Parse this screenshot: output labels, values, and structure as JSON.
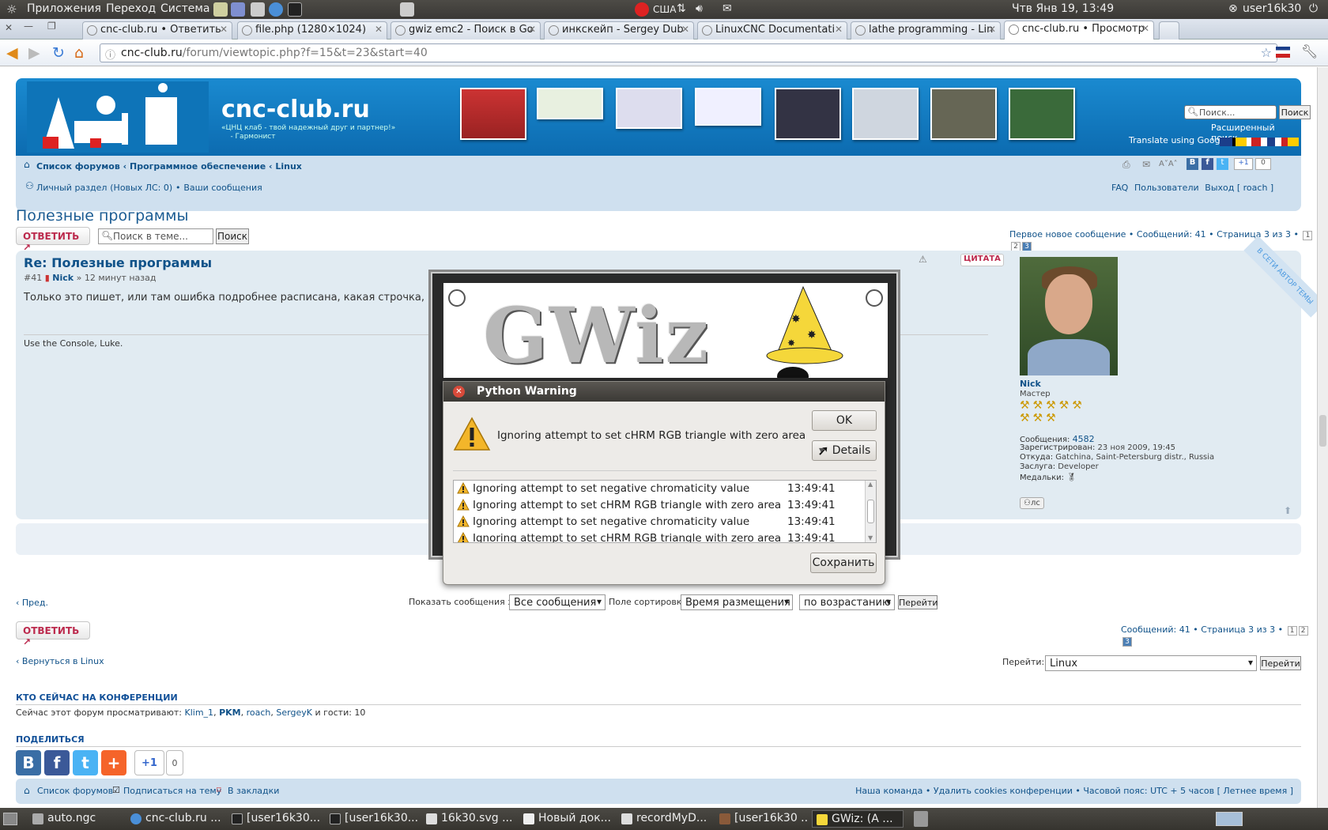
{
  "top_panel": {
    "menus": [
      "Приложения",
      "Переход",
      "Система"
    ],
    "keyboard_layout": "США",
    "clock": "Чтв Янв 19, 13:49",
    "user": "user16k30"
  },
  "tabs": [
    {
      "label": "cnc-club.ru • Ответить"
    },
    {
      "label": "file.php (1280×1024)"
    },
    {
      "label": "gwiz emc2 - Поиск в Go"
    },
    {
      "label": "инкскейп - Sergey Dub"
    },
    {
      "label": "LinuxCNC Documentati"
    },
    {
      "label": "lathe programming - Lin"
    },
    {
      "label": "cnc-club.ru • Просмотр"
    }
  ],
  "url": {
    "host": "cnc-club.ru",
    "path": "/forum/viewtopic.php?f=15&t=23&start=40"
  },
  "header": {
    "site_title": "cnc-club.ru",
    "tagline": "«ЦНЦ клаб - твой надежный друг и партнер!»",
    "tagline_author": "- Гармонист",
    "search_placeholder": "Поиск...",
    "search_button": "Поиск",
    "advanced_search": "Расширенный поиск",
    "translate": "Translate using Google:"
  },
  "breadcrumb": {
    "items": [
      "Список форумов",
      "Программное обеспечение",
      "Linux"
    ],
    "sep": " ‹ "
  },
  "usernav": {
    "personal": "Личный раздел",
    "new_pm": "(Новых ЛС: 0)",
    "your_posts": "Ваши сообщения",
    "faq": "FAQ",
    "users": "Пользователи",
    "logout": "Выход [ roach ]",
    "share_count": "0"
  },
  "topic": {
    "title": "Полезные программы",
    "reply_label": "ОТВЕТИТЬ",
    "search_placeholder": "Поиск в теме...",
    "search_button": "Поиск",
    "pagination_text": "Первое новое сообщение • Сообщений: 41 • Страница 3 из 3 •",
    "pages": [
      "1",
      "2",
      "3"
    ]
  },
  "post": {
    "title": "Re: Полезные программы",
    "number": "#41",
    "author": "Nick",
    "time": "» 12 минут назад",
    "body": "Только это пишет, или там ошибка подробнее расписана, какая строчка, где?",
    "signature": "Use the Console, Luke.",
    "quote_label": "ЦИТАТА",
    "ribbon": "В СЕТИ АВТОР ТЕМЫ"
  },
  "profile": {
    "name": "Nick",
    "rank": "Мастер",
    "posts_label": "Сообщения:",
    "posts": "4582",
    "registered_label": "Зарегистрирован:",
    "registered": "23 ноя 2009, 19:45",
    "from_label": "Откуда:",
    "from": "Gatchina, Saint-Petersburg distr., Russia",
    "merit_label": "Заслуга:",
    "merit": "Developer",
    "medals_label": "Медальки:",
    "pm_label": "лс"
  },
  "sort_bar": {
    "prev": "Пред.",
    "show_label": "Показать сообщения за:",
    "show_value": "Все сообщения",
    "sort_label": "Поле сортировки",
    "sort_value": "Время размещения",
    "order_value": "по возрастанию",
    "go": "Перейти"
  },
  "bottom": {
    "reply_label": "ОТВЕТИТЬ",
    "pagination_text": "Сообщений: 41 • Страница 3 из 3 •",
    "back_link": "Вернуться в Linux",
    "jump_label": "Перейти:",
    "jump_value": "Linux",
    "jump_button": "Перейти"
  },
  "online": {
    "title": "КТО СЕЙЧАС НА КОНФЕРЕНЦИИ",
    "prefix": "Сейчас этот форум просматривают:",
    "users": [
      "Klim_1",
      "PKM",
      "roach",
      "SergeyK"
    ],
    "suffix": "и гости: 10"
  },
  "share": {
    "title": "ПОДЕЛИТЬСЯ",
    "count": "0",
    "plus_one": "+1"
  },
  "footer": {
    "forums": "Список форумов",
    "subscribe": "Подписаться на тему",
    "bookmark": "В закладки",
    "right": "Наша команда • Удалить cookies конференции • Часовой пояс: UTC + 5 часов [ Летнее время ]"
  },
  "gwiz": {
    "logo": "GWiz"
  },
  "dialog": {
    "title": "Python Warning",
    "message": "Ignoring attempt to set cHRM RGB triangle with zero area",
    "ok": "OK",
    "details": "Details",
    "save": "Сохранить",
    "log": [
      {
        "msg": "Ignoring attempt to set negative chromaticity value",
        "time": "13:49:41"
      },
      {
        "msg": "Ignoring attempt to set cHRM RGB triangle with zero area",
        "time": "13:49:41"
      },
      {
        "msg": "Ignoring attempt to set negative chromaticity value",
        "time": "13:49:41"
      },
      {
        "msg": "Ignoring attempt to set cHRM RGB triangle with zero area",
        "time": "13:49:41"
      }
    ]
  },
  "taskbar": [
    {
      "label": "auto.ngc"
    },
    {
      "label": "cnc-club.ru ..."
    },
    {
      "label": "[user16k30..."
    },
    {
      "label": "[user16k30..."
    },
    {
      "label": "16k30.svg ..."
    },
    {
      "label": "Новый док..."
    },
    {
      "label": "recordMyD..."
    },
    {
      "label": "[user16k30 ..."
    },
    {
      "label": "GWiz: (A ..."
    }
  ]
}
